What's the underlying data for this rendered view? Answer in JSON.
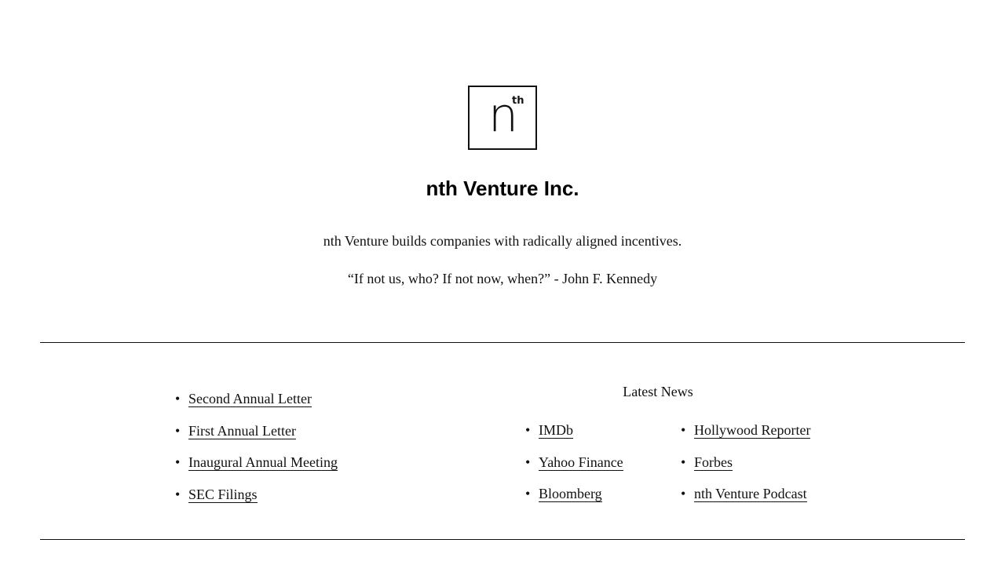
{
  "logo": {
    "letter": "n",
    "superscript": "th"
  },
  "header": {
    "company_name": "nth Venture Inc.",
    "tagline": "nth Venture builds companies with radically aligned incentives.",
    "quote": "“If not us, who? If not now, when?” - John F. Kennedy"
  },
  "letters": {
    "items": [
      {
        "label": "Second Annual Letter"
      },
      {
        "label": "First Annual Letter"
      },
      {
        "label": "Inaugural Annual Meeting"
      },
      {
        "label": "SEC Filings"
      }
    ]
  },
  "news": {
    "heading": "Latest News",
    "column_1": [
      {
        "label": "IMDb"
      },
      {
        "label": "Yahoo Finance"
      },
      {
        "label": "Bloomberg"
      }
    ],
    "column_2": [
      {
        "label": "Hollywood Reporter"
      },
      {
        "label": "Forbes"
      },
      {
        "label": "nth Venture Podcast"
      }
    ]
  },
  "bullet_glyph": "•",
  "colors": {
    "text": "#111111",
    "background": "#ffffff"
  }
}
